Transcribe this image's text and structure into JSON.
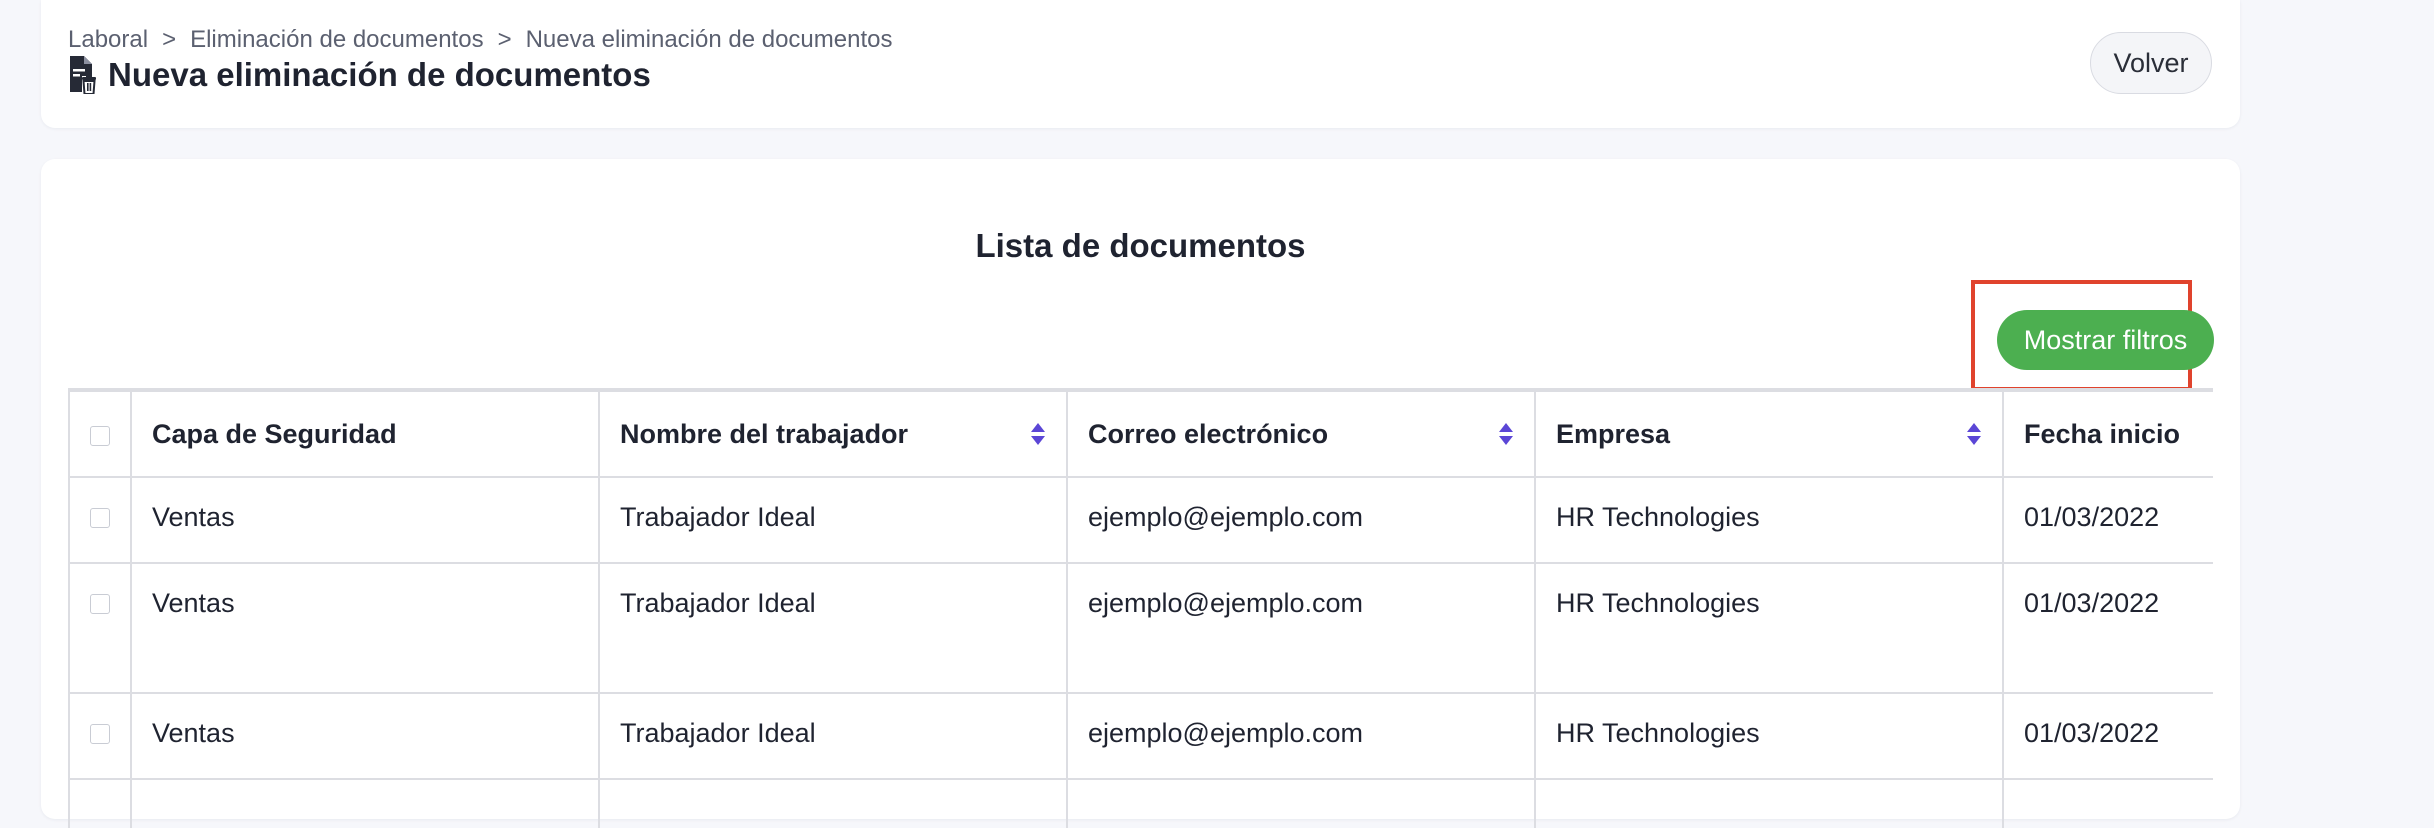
{
  "breadcrumb": {
    "items": [
      "Laboral",
      "Eliminación de documentos",
      "Nueva eliminación de documentos"
    ],
    "separator": ">"
  },
  "page": {
    "title": "Nueva eliminación de documentos",
    "title_icon": "file-trash-icon"
  },
  "header": {
    "back_label": "Volver"
  },
  "list": {
    "title": "Lista de documentos",
    "filter_button_label": "Mostrar filtros"
  },
  "table": {
    "columns": [
      {
        "label": "Capa de Seguridad",
        "sortable": false
      },
      {
        "label": "Nombre del trabajador",
        "sortable": true
      },
      {
        "label": "Correo electrónico",
        "sortable": true
      },
      {
        "label": "Empresa",
        "sortable": true
      },
      {
        "label": "Fecha inicio",
        "sortable": false
      }
    ],
    "rows": [
      {
        "capa": "Ventas",
        "nombre": "Trabajador Ideal",
        "correo": "ejemplo@ejemplo.com",
        "empresa": "HR Technologies",
        "fecha": "01/03/2022"
      },
      {
        "capa": "Ventas",
        "nombre": "Trabajador Ideal",
        "correo": "ejemplo@ejemplo.com",
        "empresa": "HR Technologies",
        "fecha": "01/03/2022"
      },
      {
        "capa": "Ventas",
        "nombre": "Trabajador Ideal",
        "correo": "ejemplo@ejemplo.com",
        "empresa": "HR Technologies",
        "fecha": "01/03/2022"
      }
    ]
  },
  "colors": {
    "accent_green": "#4caf50",
    "highlight_red": "#e0432d",
    "sort_icon_purple": "#5b46d6"
  }
}
